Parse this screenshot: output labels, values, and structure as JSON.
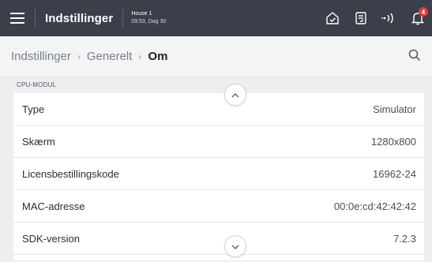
{
  "header": {
    "title": "Indstillinger",
    "house_name": "House 1",
    "house_time": "09:53, Dag 30",
    "notification_count": "4",
    "icons": [
      "menu-icon",
      "home-icon",
      "clipboard-icon",
      "radio-signal-icon",
      "bell-icon"
    ]
  },
  "breadcrumb": {
    "items": [
      "Indstillinger",
      "Generelt",
      "Om"
    ],
    "separator": "›"
  },
  "section": {
    "title": "CPU-MODUL"
  },
  "rows": [
    {
      "label": "Type",
      "value": "Simulator"
    },
    {
      "label": "Skærm",
      "value": "1280x800"
    },
    {
      "label": "Licensbestillingskode",
      "value": "16962-24"
    },
    {
      "label": "MAC-adresse",
      "value": "00:0e:cd:42:42:42"
    },
    {
      "label": "SDK-version",
      "value": "7.2.3"
    }
  ],
  "colors": {
    "topbar": "#3a3f4a",
    "badge": "#e23b3b",
    "background": "#eceef0"
  }
}
